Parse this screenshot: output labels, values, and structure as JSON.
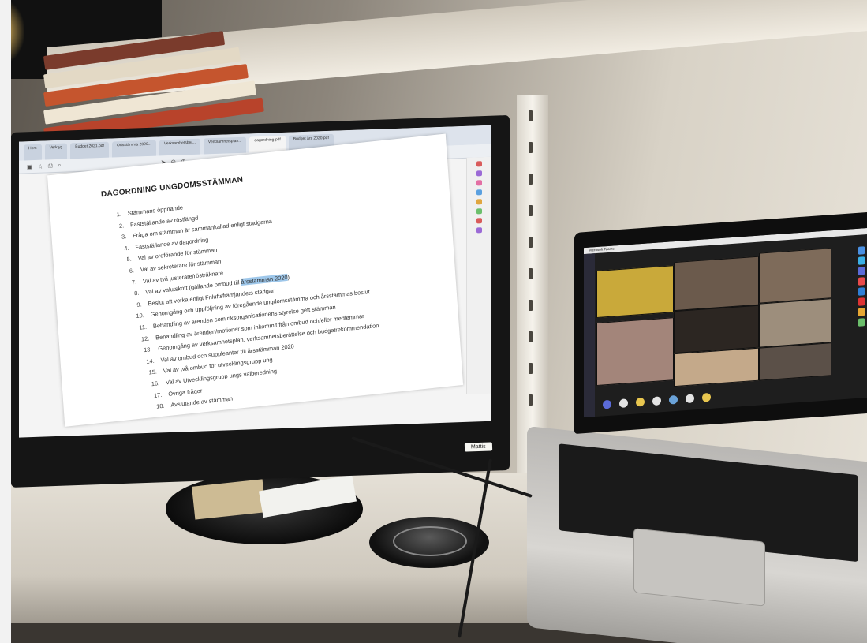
{
  "monitor": {
    "tabs": [
      "Hem",
      "Verktyg",
      "Budget 2021.pdf",
      "Ortsstämma 2020...",
      "Verksamhetsber...",
      "Verksamhetsplan...",
      "dagordning.pdf",
      "Budget års 2020.pdf"
    ],
    "active_tab_index": 6,
    "toolbar_icons": [
      "save-icon",
      "star-icon",
      "print-icon",
      "search-icon",
      "select-icon",
      "zoom-out-icon",
      "zoom-in-icon"
    ],
    "document": {
      "title": "DAGORDNING UNGDOMSSTÄMMAN",
      "items": [
        {
          "num": "1.",
          "text": "Stämmans öppnande"
        },
        {
          "num": "2.",
          "text": "Fastställande av röstlängd"
        },
        {
          "num": "3.",
          "text": "Fråga om stämman är sammankallad enligt stadgarna"
        },
        {
          "num": "4.",
          "text": "Fastställande av dagordning"
        },
        {
          "num": "5.",
          "text": "Val av ordförande för stämman"
        },
        {
          "num": "6.",
          "text": "Val av sekreterare för stämman"
        },
        {
          "num": "7.",
          "text": "Val av två justerare/rösträknare"
        },
        {
          "num": "8.",
          "text": "Val av valutskott (gällande ombud till ",
          "highlight": "årsstämman 2020",
          "after": ")"
        },
        {
          "num": "9.",
          "text": "Beslut att verka enligt Friluftsfrämjandets stadgar"
        },
        {
          "num": "10.",
          "text": "Genomgång och uppföljning av föregående ungdomsstämma och årsstämmas beslut"
        },
        {
          "num": "11.",
          "text": "Behandling av ärenden som riksorganisationens styrelse gett stämman"
        },
        {
          "num": "12.",
          "text": "Behandling av ärenden/motioner som inkommit från ombud och/eller medlemmar"
        },
        {
          "num": "13.",
          "text": "Genomgång av verksamhetsplan, verksamhetsberättelse och budgetrekommendation"
        },
        {
          "num": "14.",
          "text": "Val av ombud och suppleanter till årsstämman 2020"
        },
        {
          "num": "15.",
          "text": "Val av två ombud för utvecklingsgrupp ung"
        },
        {
          "num": "16.",
          "text": "Val av Utvecklingsgrupp ungs valberedning"
        },
        {
          "num": "17.",
          "text": "Övriga frågor"
        },
        {
          "num": "18.",
          "text": "Avslutande av stämman"
        }
      ]
    }
  },
  "laptop": {
    "app": "Microsoft Teams",
    "call_controls": [
      "camera-icon",
      "mic-icon",
      "share-icon",
      "more-icon",
      "chat-icon",
      "participants-icon",
      "hangup-icon"
    ],
    "video_tiles": 10
  },
  "cable_label": "Mattis"
}
